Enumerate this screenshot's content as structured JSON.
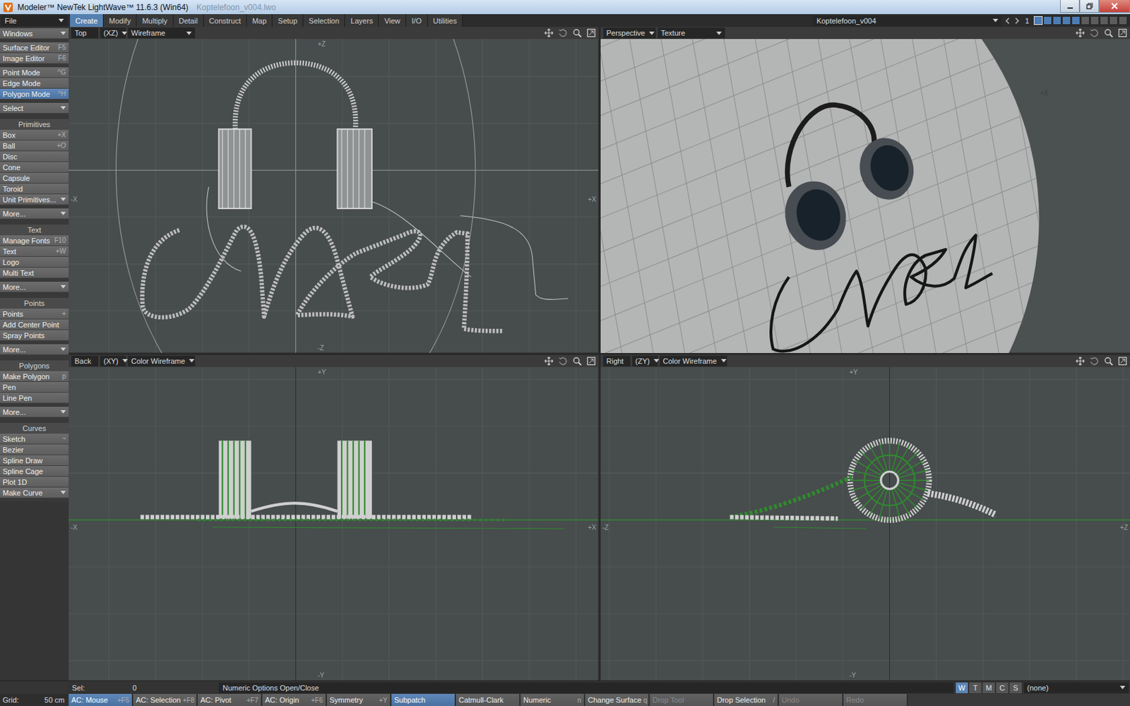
{
  "window": {
    "title": "Modeler™ NewTek LightWave™ 11.6.3 (Win64)",
    "file": "Koptelefoon_v004.lwo"
  },
  "menu": {
    "file": "File",
    "tabs": [
      {
        "label": "Create",
        "selected": true
      },
      {
        "label": "Modify",
        "selected": false
      },
      {
        "label": "Multiply",
        "selected": false
      },
      {
        "label": "Detail",
        "selected": false
      },
      {
        "label": "Construct",
        "selected": false
      },
      {
        "label": "Map",
        "selected": false
      },
      {
        "label": "Setup",
        "selected": false
      },
      {
        "label": "Selection",
        "selected": false
      },
      {
        "label": "Layers",
        "selected": false
      },
      {
        "label": "View",
        "selected": false
      },
      {
        "label": "I/O",
        "selected": false
      },
      {
        "label": "Utilities",
        "selected": false
      }
    ]
  },
  "object": {
    "name": "Koptelefoon_v004",
    "layer": "1",
    "layers": [
      {
        "filled": true,
        "selected": true
      },
      {
        "filled": true,
        "selected": false
      },
      {
        "filled": true,
        "selected": false
      },
      {
        "filled": true,
        "selected": false
      },
      {
        "filled": true,
        "selected": false
      },
      {
        "filled": false,
        "selected": false
      },
      {
        "filled": false,
        "selected": false
      },
      {
        "filled": false,
        "selected": false
      },
      {
        "filled": false,
        "selected": false
      },
      {
        "filled": false,
        "selected": false
      }
    ]
  },
  "toolbar": [
    {
      "items": [
        {
          "label": "Windows",
          "kind": "dropdown",
          "selected": false
        }
      ]
    },
    {
      "items": [
        {
          "label": "Surface Editor",
          "shortcut": "F5",
          "kind": "button",
          "selected": false
        },
        {
          "label": "Image Editor",
          "shortcut": "F6",
          "kind": "button",
          "selected": false
        }
      ]
    },
    {
      "items": [
        {
          "label": "Point Mode",
          "shortcut": "^G",
          "kind": "button",
          "selected": false
        },
        {
          "label": "Edge Mode",
          "kind": "button",
          "selected": false
        },
        {
          "label": "Polygon Mode",
          "shortcut": "^H",
          "kind": "button",
          "selected": true
        }
      ]
    },
    {
      "items": [
        {
          "label": "Select",
          "kind": "dropdown",
          "selected": false
        }
      ]
    },
    {
      "header": "Primitives",
      "items": [
        {
          "label": "Box",
          "shortcut": "+X",
          "kind": "button",
          "selected": false
        },
        {
          "label": "Ball",
          "shortcut": "+O",
          "kind": "button",
          "selected": false
        },
        {
          "label": "Disc",
          "kind": "button",
          "selected": false
        },
        {
          "label": "Cone",
          "kind": "button",
          "selected": false
        },
        {
          "label": "Capsule",
          "kind": "button",
          "selected": false
        },
        {
          "label": "Toroid",
          "kind": "button",
          "selected": false
        },
        {
          "label": "Unit Primitives...",
          "kind": "dropdown",
          "selected": false
        }
      ]
    },
    {
      "items": [
        {
          "label": "More...",
          "kind": "dropdown",
          "selected": false
        }
      ]
    },
    {
      "header": "Text",
      "items": [
        {
          "label": "Manage Fonts",
          "shortcut": "F10",
          "kind": "button",
          "selected": false
        },
        {
          "label": "Text",
          "shortcut": "+W",
          "kind": "button",
          "selected": false
        },
        {
          "label": "Logo",
          "kind": "button",
          "selected": false
        },
        {
          "label": "Multi Text",
          "kind": "button",
          "selected": false
        }
      ]
    },
    {
      "items": [
        {
          "label": "More...",
          "kind": "dropdown",
          "selected": false
        }
      ]
    },
    {
      "header": "Points",
      "items": [
        {
          "label": "Points",
          "shortcut": "+",
          "kind": "button",
          "selected": false
        },
        {
          "label": "Add Center Point",
          "kind": "button",
          "selected": false
        },
        {
          "label": "Spray Points",
          "kind": "button",
          "selected": false
        }
      ]
    },
    {
      "items": [
        {
          "label": "More...",
          "kind": "dropdown",
          "selected": false
        }
      ]
    },
    {
      "header": "Polygons",
      "items": [
        {
          "label": "Make Polygon",
          "shortcut": "p",
          "kind": "button",
          "selected": false
        },
        {
          "label": "Pen",
          "kind": "button",
          "selected": false
        },
        {
          "label": "Line Pen",
          "kind": "button",
          "selected": false
        }
      ]
    },
    {
      "items": [
        {
          "label": "More...",
          "kind": "dropdown",
          "selected": false
        }
      ]
    },
    {
      "header": "Curves",
      "items": [
        {
          "label": "Sketch",
          "shortcut": "~",
          "kind": "button",
          "selected": false
        },
        {
          "label": "Bezier",
          "kind": "button",
          "selected": false
        },
        {
          "label": "Spline Draw",
          "kind": "button",
          "selected": false
        },
        {
          "label": "Spline Cage",
          "kind": "button",
          "selected": false
        },
        {
          "label": "Plot 1D",
          "kind": "button",
          "selected": false
        },
        {
          "label": "Make Curve",
          "kind": "dropdown",
          "selected": false
        }
      ]
    }
  ],
  "viewports": [
    {
      "kind": "top",
      "view": "Top",
      "axes": "(XZ)",
      "mode": "Wireframe",
      "labels": {
        "top": "+Z",
        "bottom": "-Z",
        "left": "-X",
        "right": "+X"
      }
    },
    {
      "kind": "perspective",
      "view": "Perspective",
      "mode": "Texture",
      "labels": {
        "right": "+X"
      }
    },
    {
      "kind": "back",
      "view": "Back",
      "axes": "(XY)",
      "mode": "Color Wireframe",
      "labels": {
        "top": "+Y",
        "bottom": "-Y",
        "left": "-X",
        "right": "+X"
      }
    },
    {
      "kind": "right",
      "view": "Right",
      "axes": "(ZY)",
      "mode": "Color Wireframe",
      "labels": {
        "top": "+Y",
        "bottom": "-Y",
        "left": "-Z",
        "right": "+Z"
      }
    }
  ],
  "status": {
    "selection": {
      "label": "Sel:",
      "count": "0"
    },
    "hint": "Numeric Options Open/Close",
    "view_modes": [
      {
        "label": "W",
        "selected": true
      },
      {
        "label": "T",
        "selected": false
      },
      {
        "label": "M",
        "selected": false
      },
      {
        "label": "C",
        "selected": false
      },
      {
        "label": "S",
        "selected": false
      }
    ],
    "surface": "(none)"
  },
  "bottom_bar": {
    "grid": {
      "label": "Grid:",
      "value": "50 cm"
    },
    "buttons": [
      {
        "label": "AC: Mouse",
        "shortcut": "+F5",
        "selected": true,
        "disabled": false
      },
      {
        "label": "AC: Selection",
        "shortcut": "+F8",
        "selected": false,
        "disabled": false
      },
      {
        "label": "AC: Pivot",
        "shortcut": "+F7",
        "selected": false,
        "disabled": false
      },
      {
        "label": "AC: Origin",
        "shortcut": "+F6",
        "selected": false,
        "disabled": false
      },
      {
        "label": "Symmetry",
        "shortcut": "+Y",
        "selected": false,
        "disabled": false
      },
      {
        "label": "Subpatch",
        "selected": true,
        "disabled": false
      },
      {
        "label": "Catmull-Clark",
        "selected": false,
        "disabled": false
      },
      {
        "label": "Numeric",
        "shortcut": "n",
        "selected": false,
        "disabled": false
      },
      {
        "label": "Change Surface",
        "shortcut": "q",
        "selected": false,
        "disabled": false
      },
      {
        "label": "Drop Tool",
        "selected": false,
        "disabled": true
      },
      {
        "label": "Drop Selection",
        "shortcut": "/",
        "selected": false,
        "disabled": false
      },
      {
        "label": "Undo",
        "selected": false,
        "disabled": true
      },
      {
        "label": "Redo",
        "selected": false,
        "disabled": true
      }
    ]
  }
}
